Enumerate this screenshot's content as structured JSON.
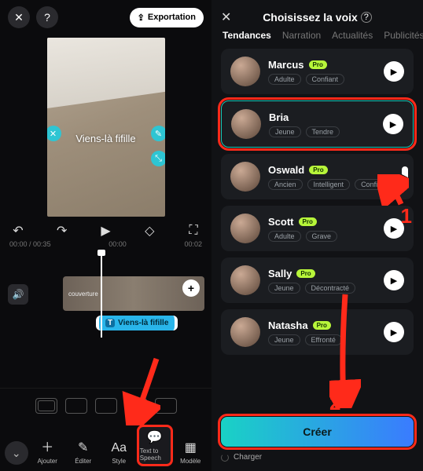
{
  "editor": {
    "export_label": "Exportation",
    "caption_text": "Viens-là fifille",
    "time_current": "00:00",
    "time_total": "00:35",
    "tick_a": "00:00",
    "tick_b": "00:02",
    "cover_label": "couverture",
    "text_clip_label": "Viens-là fifille",
    "bottom": {
      "ajouter": "Ajouter",
      "editer": "Éditer",
      "style": "Style",
      "tts": "Text to Speech",
      "modele": "Modèle"
    }
  },
  "picker": {
    "title": "Choisissez la voix",
    "tabs": {
      "tendances": "Tendances",
      "narration": "Narration",
      "actualites": "Actualités",
      "publicites": "Publicités"
    },
    "voices": [
      {
        "name": "Marcus",
        "pro": true,
        "tags": [
          "Adulte",
          "Confiant"
        ]
      },
      {
        "name": "Bria",
        "pro": false,
        "tags": [
          "Jeune",
          "Tendre"
        ]
      },
      {
        "name": "Oswald",
        "pro": true,
        "tags": [
          "Ancien",
          "Intelligent",
          "Confiant"
        ]
      },
      {
        "name": "Scott",
        "pro": true,
        "tags": [
          "Adulte",
          "Grave"
        ]
      },
      {
        "name": "Sally",
        "pro": true,
        "tags": [
          "Jeune",
          "Décontracté"
        ]
      },
      {
        "name": "Natasha",
        "pro": true,
        "tags": [
          "Jeune",
          "Effronté"
        ]
      }
    ],
    "create_label": "Créer",
    "loading_label": "Charger",
    "badge1": "1",
    "badge2": "2",
    "pro_label": "Pro"
  }
}
